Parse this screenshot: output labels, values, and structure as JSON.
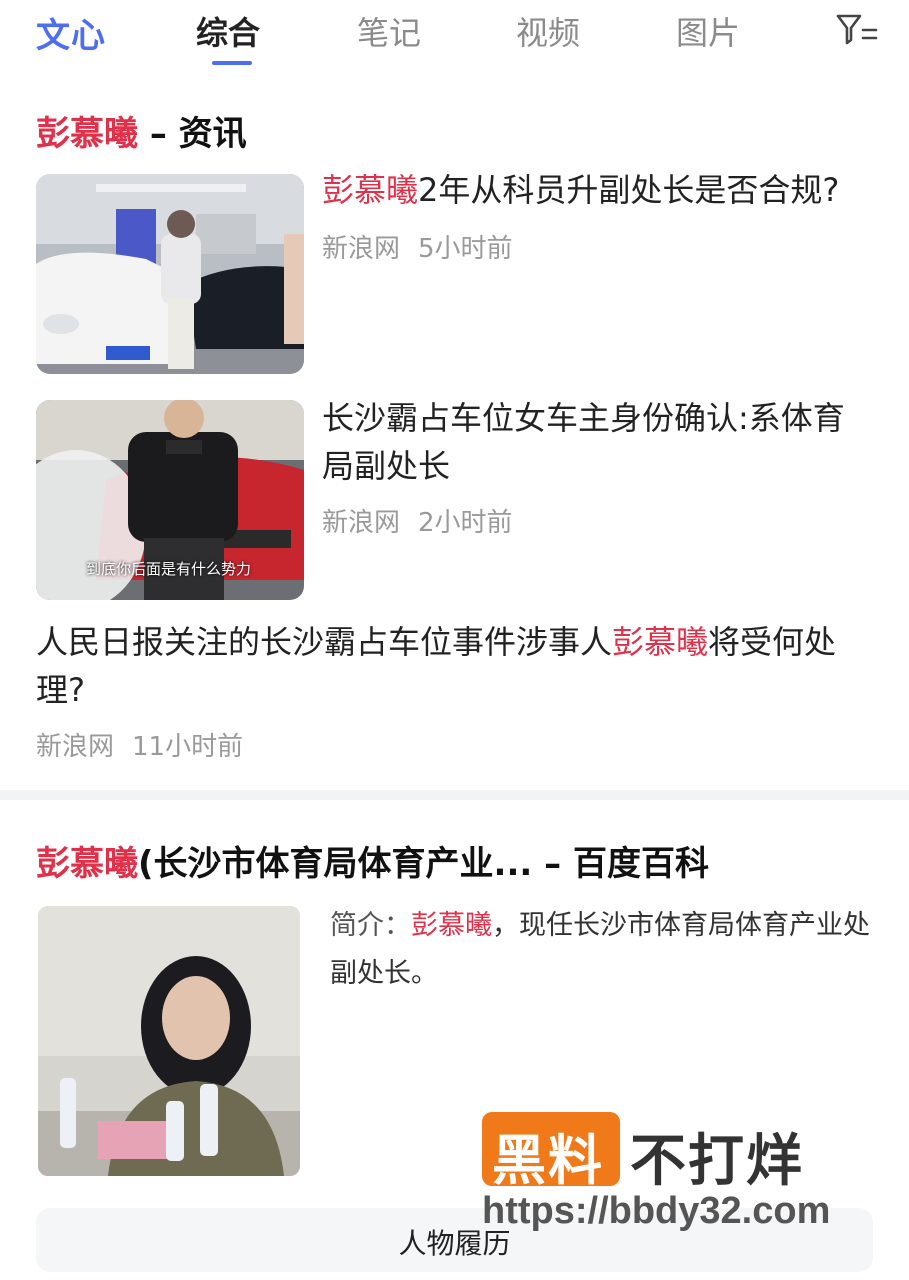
{
  "header": {
    "logo_text": "文心",
    "tabs": [
      {
        "label": "综合",
        "active": true
      },
      {
        "label": "笔记",
        "active": false
      },
      {
        "label": "视频",
        "active": false
      },
      {
        "label": "图片",
        "active": false
      }
    ],
    "filter_icon": "filter-icon",
    "accent_color": "#4e6ef2"
  },
  "news_section": {
    "title_highlight": "彭慕曦",
    "title_rest": " – 资讯",
    "items": [
      {
        "title_highlight": "彭慕曦",
        "title_rest": "2年从科员升副处长是否合规?",
        "source": "新浪网",
        "time": "5小时前"
      },
      {
        "title": "长沙霸占车位女车主身份确认:系体育局副处长",
        "source": "新浪网",
        "time": "2小时前",
        "image_caption": "到底你后面是有什么势力"
      },
      {
        "title_before": "人民日报关注的长沙霸占车位事件涉事人",
        "title_highlight": "彭慕曦",
        "title_after": "将受何处理?",
        "source": "新浪网",
        "time": "11小时前"
      }
    ]
  },
  "baike_section": {
    "title_highlight": "彭慕曦",
    "title_rest": "(长沙市体育局体育产业... – 百度百科",
    "summary_label": "简介：",
    "summary_highlight": "彭慕曦",
    "summary_rest": "，现任长沙市体育局体育产业处副处长。",
    "button_label": "人物履历"
  },
  "watermark": {
    "box_text": "黑料",
    "text": "不打烊",
    "url": "https://bbdy32.com"
  },
  "colors": {
    "highlight": "#e0314b",
    "meta_gray": "#9a9a9a",
    "watermark_orange": "#f07a1a"
  }
}
